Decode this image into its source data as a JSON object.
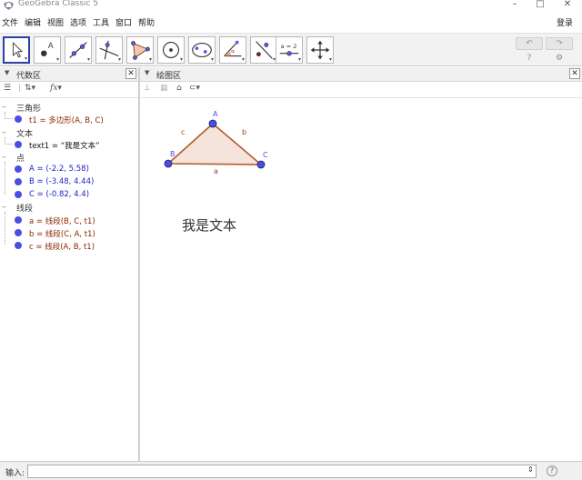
{
  "window": {
    "title": "GeoGebra Classic 5",
    "min_label": "–",
    "max_label": "□",
    "close_label": "✕"
  },
  "menu": {
    "items": [
      "文件",
      "编辑",
      "视图",
      "选项",
      "工具",
      "窗口",
      "帮助"
    ],
    "login": "登录"
  },
  "toolbar": {
    "tools": [
      "move-tool",
      "point-tool",
      "line-tool",
      "perpendicular-line-tool",
      "polygon-tool",
      "circle-tool",
      "conic-tool",
      "angle-tool",
      "reflect-tool",
      "slider-tool",
      "move-graphics-tool"
    ],
    "undo": "↶",
    "redo": "↷",
    "help": "?",
    "settings": "⚙",
    "slider_label": "a = 2"
  },
  "algebra_panel": {
    "title": "代数区",
    "close": "✕",
    "groups": [
      {
        "name": "三角形",
        "items": [
          {
            "text": "t1 = 多边形(A, B, C)",
            "color": "#8b2500",
            "dot": "#4a4fe3"
          }
        ]
      },
      {
        "name": "文本",
        "items": [
          {
            "text": "text1 = “我是文本”",
            "color": "#111111",
            "dot": "#4a4fe3"
          }
        ]
      },
      {
        "name": "点",
        "items": [
          {
            "text": "A = (-2.2, 5.58)",
            "color": "#1c1cc8",
            "dot": "#4a4fe3"
          },
          {
            "text": "B = (-3.48, 4.44)",
            "color": "#1c1cc8",
            "dot": "#4a4fe3"
          },
          {
            "text": "C = (-0.82, 4.4)",
            "color": "#1c1cc8",
            "dot": "#4a4fe3"
          }
        ]
      },
      {
        "name": "线段",
        "items": [
          {
            "text": "a = 线段(B, C, t1)",
            "color": "#8b2500",
            "dot": "#4a4fe3"
          },
          {
            "text": "b = 线段(C, A, t1)",
            "color": "#8b2500",
            "dot": "#4a4fe3"
          },
          {
            "text": "c = 线段(A, B, t1)",
            "color": "#8b2500",
            "dot": "#4a4fe3"
          }
        ]
      }
    ]
  },
  "graphics_panel": {
    "title": "绘图区",
    "close": "✕",
    "canvas_text": "我是文本",
    "point_labels": {
      "A": "A",
      "B": "B",
      "C": "C"
    },
    "segment_labels": {
      "a": "a",
      "b": "b",
      "c": "c"
    },
    "colors": {
      "triangle_fill": "#f4e4dc",
      "triangle_stroke": "#b25b2f",
      "point": "#4a4fe3",
      "point_label": "#4a4fe3",
      "segment_label": "#8b4a2a"
    }
  },
  "input_bar": {
    "label": "输入:",
    "value": "",
    "help": "?"
  }
}
